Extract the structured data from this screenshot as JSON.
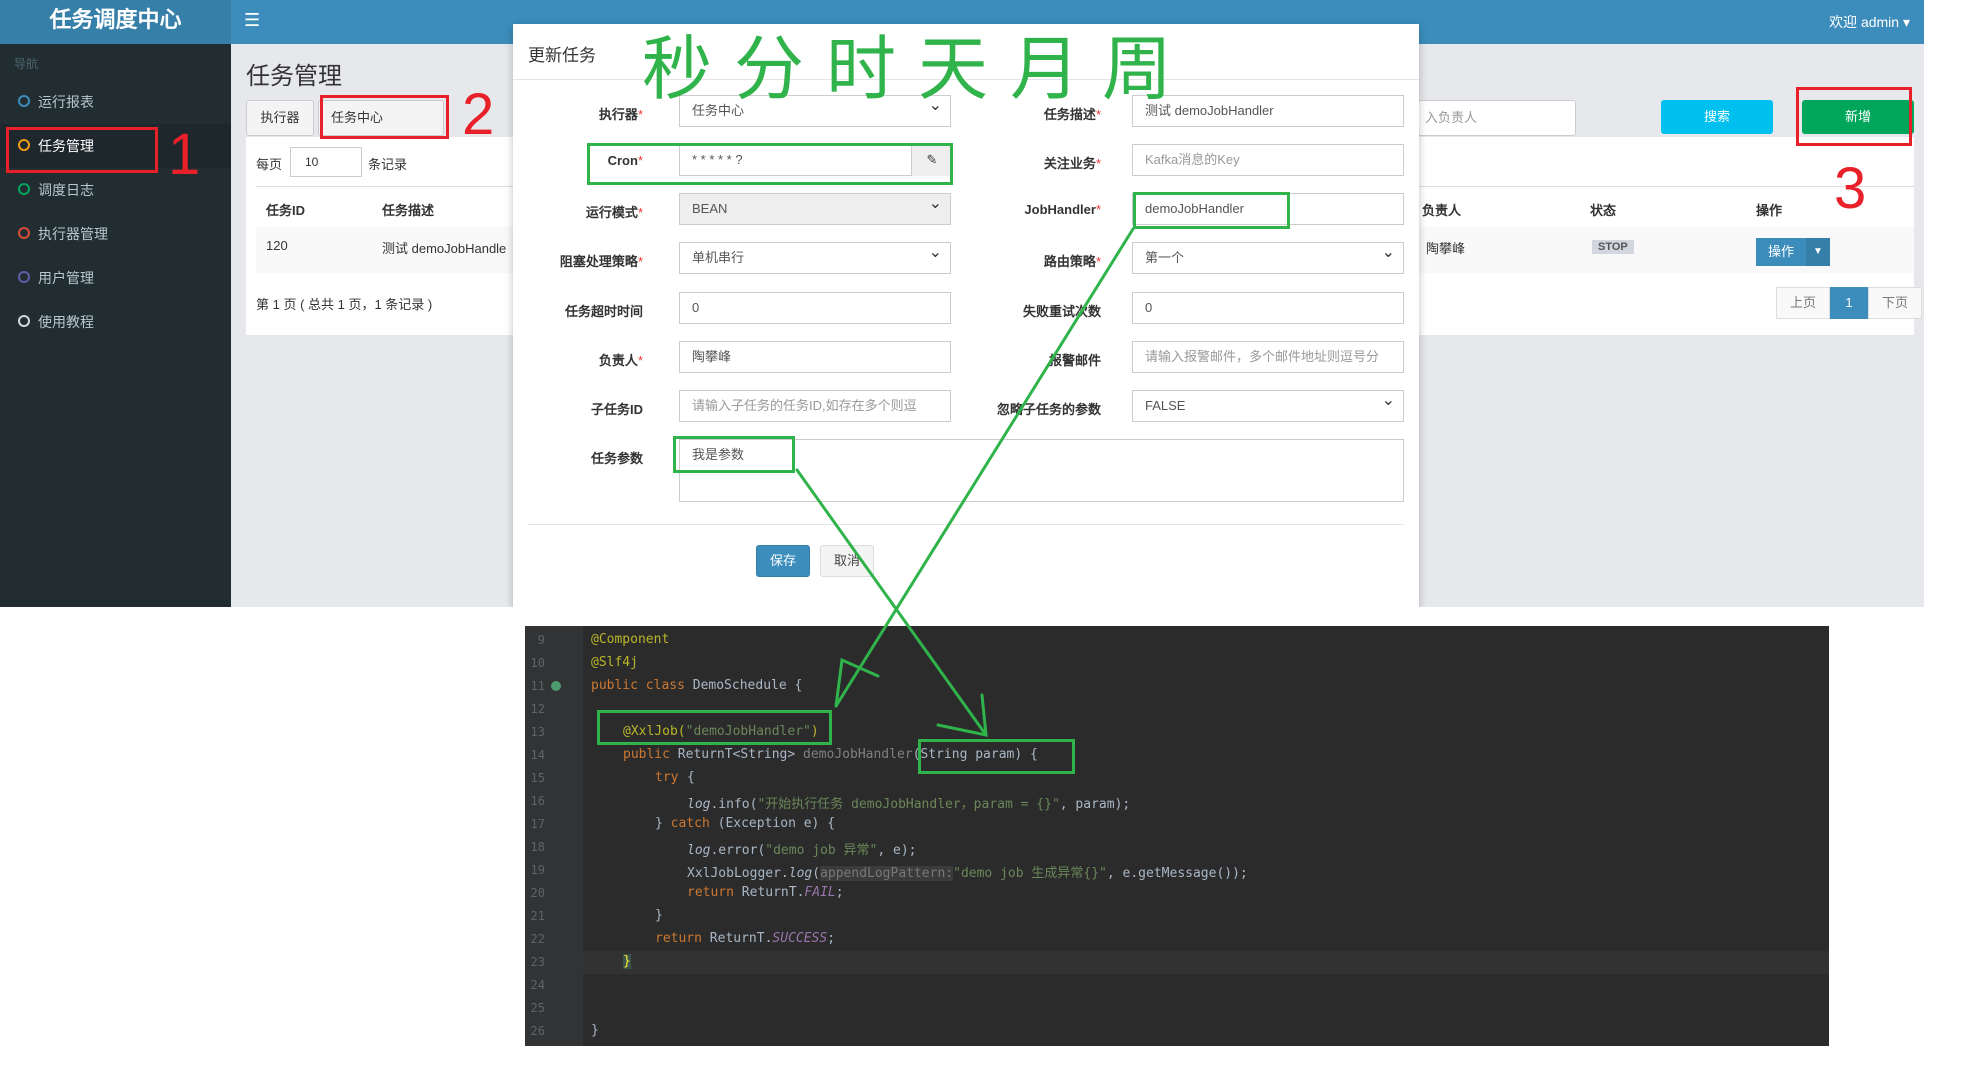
{
  "app": {
    "brand": "任务调度中心",
    "user_menu": "欢迎 admin ▾",
    "nav_header": "导航",
    "nav": [
      {
        "label": "运行报表",
        "color": "#3c8dbc"
      },
      {
        "label": "任务管理",
        "color": "#f39c12"
      },
      {
        "label": "调度日志",
        "color": "#00a65a"
      },
      {
        "label": "执行器管理",
        "color": "#dd4b39"
      },
      {
        "label": "用户管理",
        "color": "#605ca8"
      },
      {
        "label": "使用教程",
        "color": "#d2d6de"
      }
    ],
    "page_title": "任务管理",
    "filter": {
      "executor_label": "执行器",
      "executor_value": "任务中心",
      "owner_placeholder": "入负责人",
      "search": "搜索",
      "add": "新增"
    },
    "paging": {
      "per_page": "每页",
      "per_page_value": "10",
      "records": "条记录",
      "summary": "第 1 页 ( 总共 1 页，1 条记录 )",
      "prev": "上页",
      "page": "1",
      "next": "下页"
    },
    "table": {
      "headers": [
        "任务ID",
        "任务描述",
        "负责人",
        "状态",
        "操作"
      ],
      "row": {
        "id": "120",
        "desc": "测试 demoJobHandle",
        "owner": "陶攀峰",
        "status": "STOP",
        "action": "操作"
      }
    }
  },
  "modal": {
    "title": "更新任务",
    "fields": {
      "executor": {
        "label": "执行器",
        "value": "任务中心"
      },
      "desc": {
        "label": "任务描述",
        "value": "测试 demoJobHandler"
      },
      "cron": {
        "label": "Cron",
        "value": "* * * * * ?"
      },
      "biz": {
        "label": "关注业务",
        "placeholder": "Kafka消息的Key"
      },
      "mode": {
        "label": "运行模式",
        "value": "BEAN"
      },
      "handler": {
        "label": "JobHandler",
        "value": "demoJobHandler"
      },
      "block": {
        "label": "阻塞处理策略",
        "value": "单机串行"
      },
      "route": {
        "label": "路由策略",
        "value": "第一个"
      },
      "timeout": {
        "label": "任务超时时间",
        "value": "0"
      },
      "retry": {
        "label": "失败重试次数",
        "value": "0"
      },
      "owner": {
        "label": "负责人",
        "value": "陶攀峰"
      },
      "email": {
        "label": "报警邮件",
        "placeholder": "请输入报警邮件，多个邮件地址则逗号分"
      },
      "child": {
        "label": "子任务ID",
        "placeholder": "请输入子任务的任务ID,如存在多个则逗"
      },
      "ignore": {
        "label": "忽略子任务的参数",
        "value": "FALSE"
      },
      "param": {
        "label": "任务参数",
        "value": "我是参数"
      }
    },
    "save": "保存",
    "cancel": "取消"
  },
  "annotations": {
    "overlay_text": "秒分时天月周",
    "numbers": [
      "1",
      "2",
      "3"
    ],
    "colors": {
      "red": "#e8202a",
      "green": "#2fb34a"
    }
  },
  "code": {
    "line_numbers": [
      "9",
      "10",
      "11",
      "12",
      "13",
      "14",
      "15",
      "16",
      "17",
      "18",
      "19",
      "20",
      "21",
      "22",
      "23",
      "24",
      "25",
      "26"
    ],
    "annotations_top": [
      "@Component",
      "@Slf4j"
    ],
    "class_decl": {
      "kw": "public class ",
      "name": "DemoSchedule {"
    },
    "xxljob": {
      "ann": "@XxlJob(",
      "arg": "\"demoJobHandler\"",
      "close": ")"
    },
    "method": {
      "pre": "public ",
      "type": "ReturnT<String> ",
      "name": "demoJobHandler",
      "sig": "(String param) {"
    },
    "try_kw": "try",
    "log_info": {
      "obj": "log",
      "call": ".info(",
      "str": "\"开始执行任务 demoJobHandler，param = {}\"",
      "rest": ", param);"
    },
    "catch_line": {
      "pre": "} ",
      "kw": "catch",
      "rest": " (Exception e) {"
    },
    "log_error": {
      "obj": "log",
      "call": ".error(",
      "str": "\"demo job 异常\"",
      "rest": ", e);"
    },
    "xxl_log": {
      "pre": "XxlJobLogger.",
      "fn": "log",
      "open": "(",
      "hint": "appendLogPattern:",
      "str": "\"demo job 生成异常{}\"",
      "rest": ", e.getMessage());"
    },
    "return_fail": {
      "kw": "return ",
      "cls": "ReturnT.",
      "const": "FAIL",
      "end": ";"
    },
    "close_brace": "}",
    "return_success": {
      "kw": "return ",
      "cls": "ReturnT.",
      "const": "SUCCESS",
      "end": ";"
    }
  }
}
